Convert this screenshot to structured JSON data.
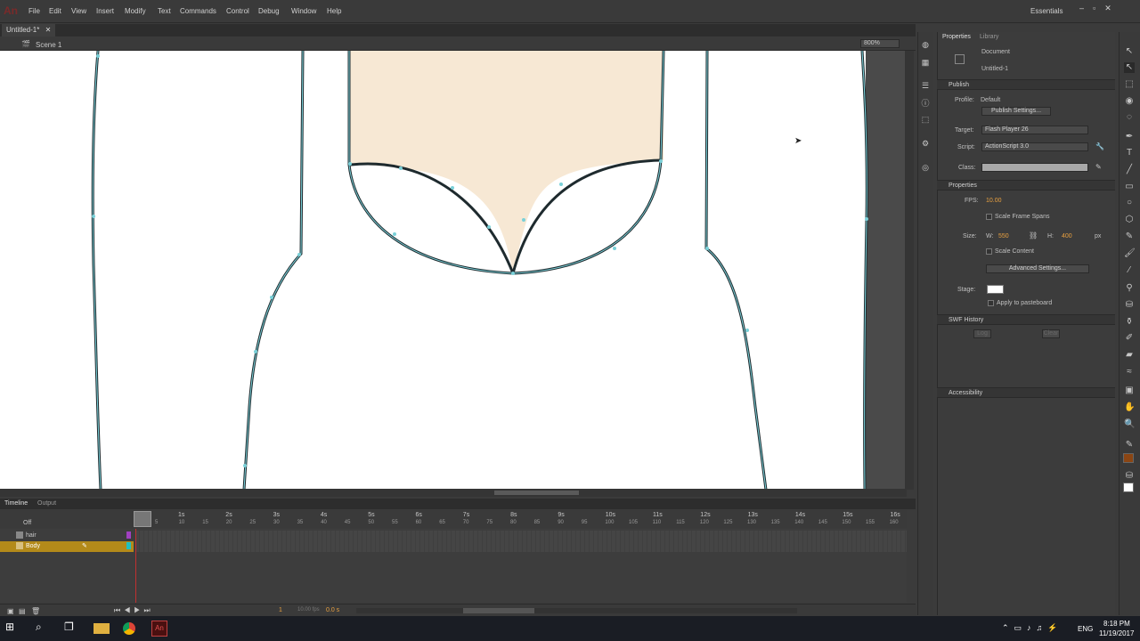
{
  "app": {
    "logo": "An",
    "essentials": "Essentials"
  },
  "menu": [
    "File",
    "Edit",
    "View",
    "Insert",
    "Modify",
    "Text",
    "Commands",
    "Control",
    "Debug",
    "Window",
    "Help"
  ],
  "doc_tab": "Untitled-1*",
  "scene": "Scene 1",
  "zoom": "800%",
  "timeline": {
    "tabs": [
      "Timeline",
      "Output"
    ],
    "off_label": "Off",
    "layers": [
      "hair",
      "Body"
    ],
    "seconds": [
      "1s",
      "2s",
      "3s",
      "4s",
      "5s",
      "6s",
      "7s",
      "8s",
      "9s",
      "10s",
      "11s",
      "12s",
      "13s",
      "14s",
      "15s",
      "16s"
    ],
    "frames": [
      "5",
      "10",
      "15",
      "20",
      "25",
      "30",
      "35",
      "40",
      "45",
      "50",
      "55",
      "60",
      "65",
      "70",
      "75",
      "80",
      "85",
      "90",
      "95",
      "100",
      "105",
      "110",
      "115",
      "120",
      "125",
      "130",
      "135",
      "140",
      "145",
      "150",
      "155",
      "160"
    ],
    "current_frame": "1",
    "fps_readout": "10.00 fps",
    "time_readout": "0.0 s"
  },
  "panels": {
    "tabs": [
      "Properties",
      "Library"
    ],
    "document_type": "Document",
    "document_name": "Untitled-1",
    "publish": {
      "header": "Publish",
      "profile_label": "Profile:",
      "profile_value": "Default",
      "settings_button": "Publish Settings...",
      "target_label": "Target:",
      "target_value": "Flash Player 26",
      "script_label": "Script:",
      "script_value": "ActionScript 3.0",
      "class_label": "Class:"
    },
    "properties": {
      "header": "Properties",
      "fps_label": "FPS:",
      "fps_value": "10.00",
      "scale_spans": "Scale Frame Spans",
      "size_label": "Size:",
      "w_label": "W:",
      "w_value": "550",
      "h_label": "H:",
      "h_value": "400",
      "unit": "px",
      "scale_content": "Scale Content",
      "advanced_button": "Advanced Settings...",
      "stage_label": "Stage:",
      "stage_color": "#ffffff",
      "apply_pasteboard": "Apply to pasteboard"
    },
    "swf": {
      "header": "SWF History",
      "log": "Log",
      "clear": "Clear"
    },
    "accessibility": {
      "header": "Accessibility"
    }
  },
  "colors": {
    "skin": "#f7e8d4",
    "fill_swatch": "#8b4513",
    "timeline_active": "#b38a1a"
  },
  "taskbar": {
    "lang": "ENG",
    "time": "8:18 PM",
    "date": "11/19/2017"
  }
}
